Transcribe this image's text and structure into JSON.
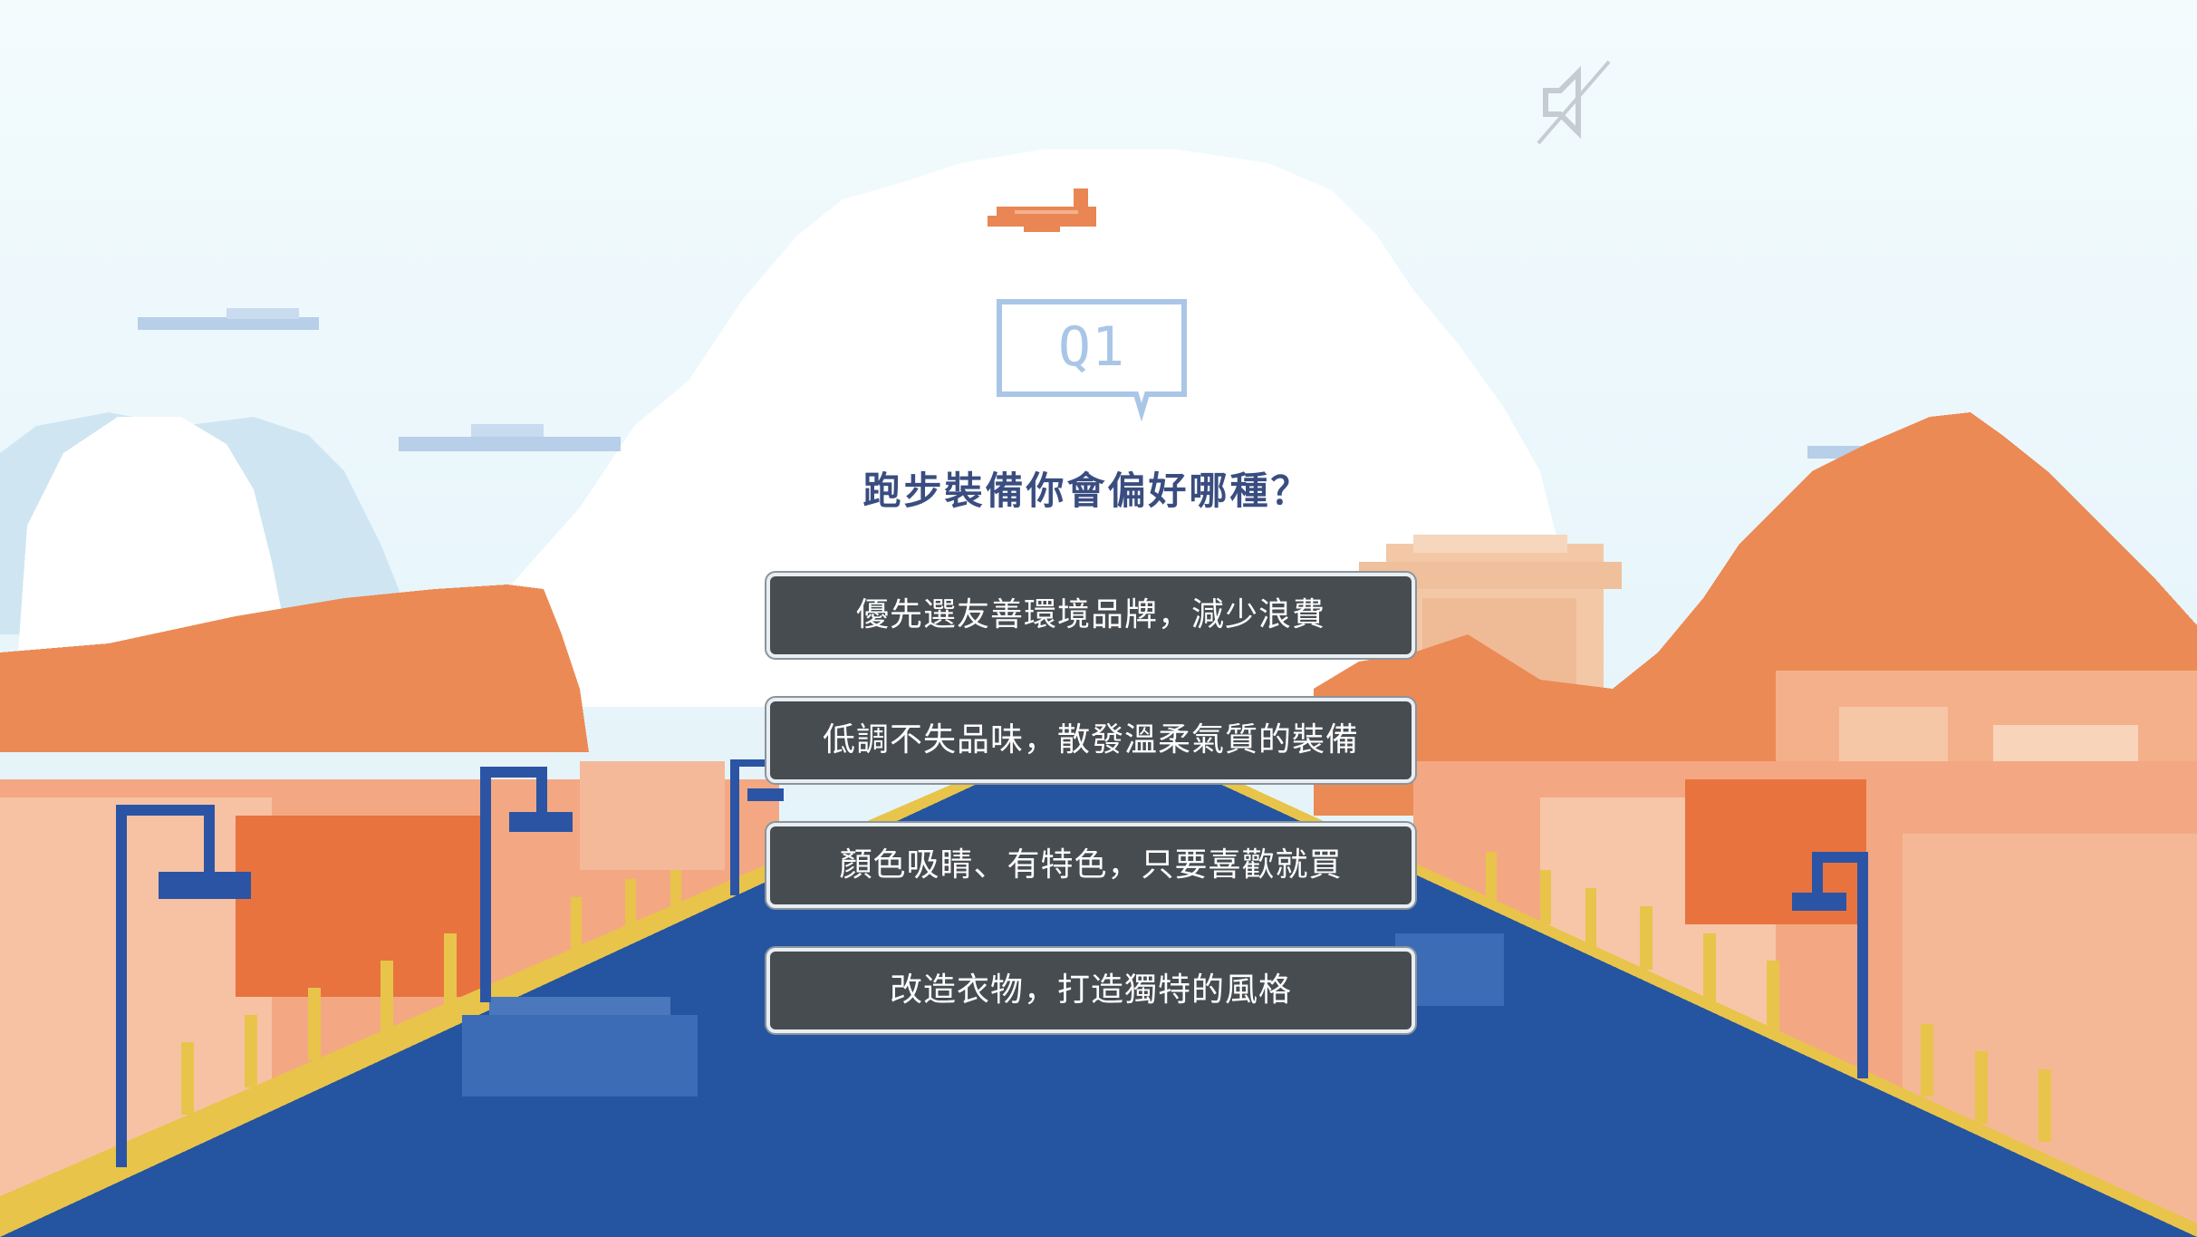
{
  "game": {
    "question_badge": "Q1",
    "question": "跑步裝備你會偏好哪種？",
    "options": [
      {
        "label": "優先選友善環境品牌，減少浪費"
      },
      {
        "label": "低調不失品味，散發溫柔氣質的裝備"
      },
      {
        "label": "顏色吸睛、有特色，只要喜歡就買"
      },
      {
        "label": "改造衣物，打造獨特的風格"
      }
    ]
  },
  "controls": {
    "sound_icon": "speaker-muted-icon"
  },
  "colors": {
    "sky": "#eaf6fb",
    "mountain": "#ec8a55",
    "road": "#2554a0",
    "road_edge": "#e8c44a",
    "lamp": "#2c54a5",
    "button_bg": "#474c51",
    "question_text": "#3a4d80",
    "badge": "#a9c6e7"
  }
}
